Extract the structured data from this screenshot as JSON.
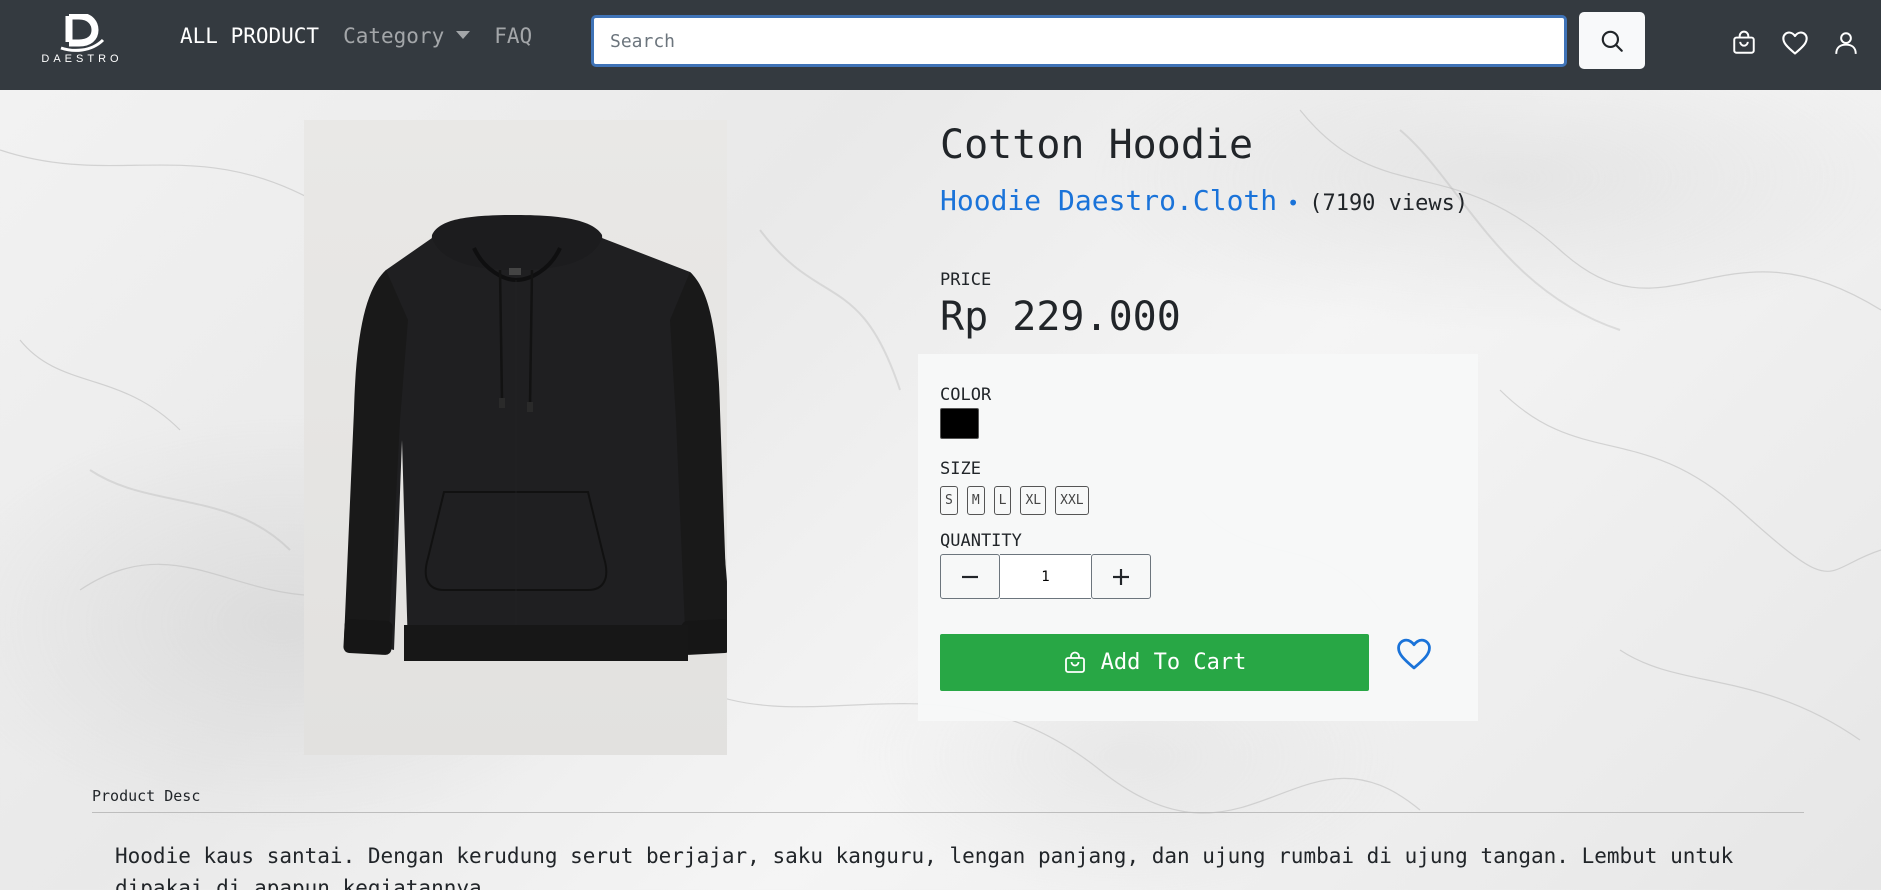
{
  "navbar": {
    "logo_text": "DAESTRO",
    "links": [
      {
        "label": "ALL PRODUCT",
        "active": true
      },
      {
        "label": "Category",
        "dropdown": true
      },
      {
        "label": "FAQ"
      }
    ],
    "search": {
      "placeholder": "Search",
      "value": ""
    },
    "icons": [
      "search-icon",
      "shopping-bag-icon",
      "heart-icon",
      "user-icon"
    ]
  },
  "product": {
    "title": "Cotton Hoodie",
    "brand": "Hoodie Daestro.Cloth",
    "separator": "•",
    "views": "(7190 views)",
    "price_label": "PRICE",
    "price": "Rp 229.000",
    "color_label": "COLOR",
    "colors": [
      "#000000"
    ],
    "size_label": "SIZE",
    "sizes": [
      "S",
      "M",
      "L",
      "XL",
      "XXL"
    ],
    "quantity_label": "QUANTITY",
    "quantity": "1",
    "add_to_cart_label": "Add To Cart",
    "image_icon": "black-hoodie-image"
  },
  "description": {
    "tab_label": "Product Desc",
    "text": "Hoodie kaus santai. Dengan kerudung serut berjajar, saku kanguru, lengan panjang, dan ujung rumbai di ujung tangan. Lembut untuk dipakai di apapun kegiatannya."
  },
  "colors": {
    "navbar_bg": "#343a40",
    "accent_blue": "#1a73d9",
    "cart_green": "#28a745"
  }
}
